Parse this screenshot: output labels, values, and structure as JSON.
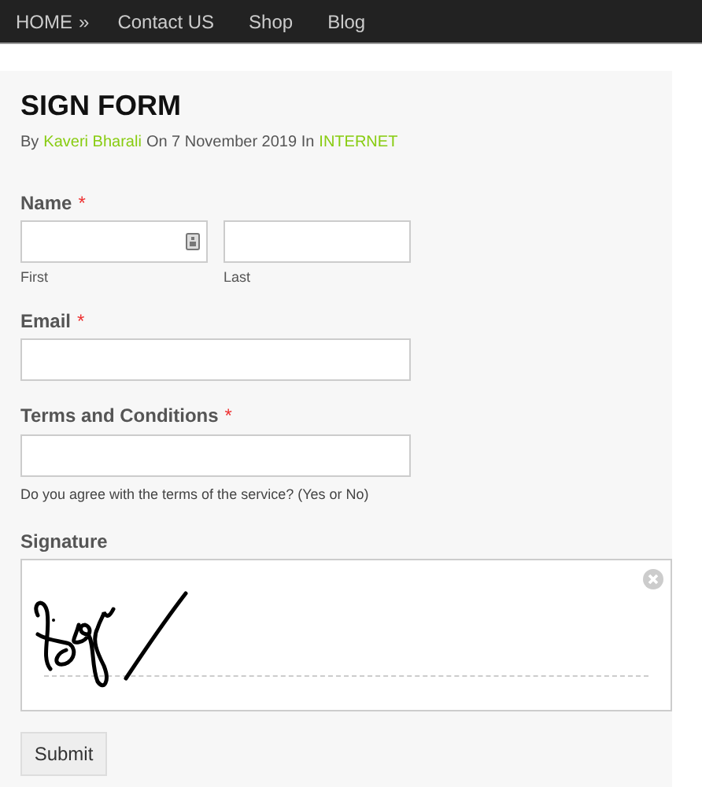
{
  "nav": {
    "items": [
      {
        "label": "HOME",
        "separator": "»"
      },
      {
        "label": "Contact US"
      },
      {
        "label": "Shop"
      },
      {
        "label": "Blog"
      }
    ]
  },
  "post": {
    "title": "SIGN FORM",
    "by": "By",
    "author": "Kaveri Bharali",
    "date_text": "On 7 November 2019 In",
    "category": "INTERNET"
  },
  "form": {
    "fields": [
      {
        "kind": "name",
        "label": "Name",
        "required_mark": "*",
        "parts": [
          {
            "sublabel": "First"
          },
          {
            "sublabel": "Last"
          }
        ]
      },
      {
        "kind": "text",
        "label": "Email",
        "required_mark": "*"
      },
      {
        "kind": "text",
        "label": "Terms and Conditions",
        "required_mark": "*",
        "hint": "Do you agree with the terms of the service? (Yes or No)"
      },
      {
        "kind": "signature",
        "label": "Signature",
        "signed": true
      }
    ],
    "submit": "Submit"
  }
}
